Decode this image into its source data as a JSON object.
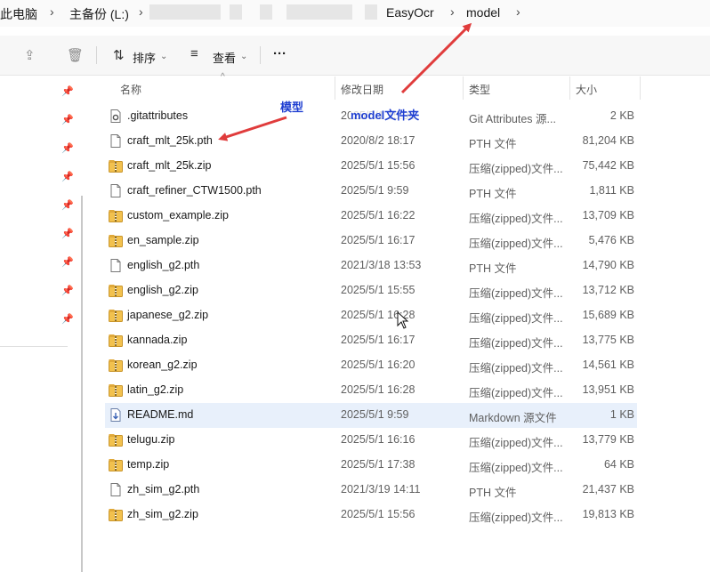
{
  "address_bar": {
    "crumbs": [
      "此电脑",
      "主备份 (L:)",
      "EasyOcr",
      "model"
    ]
  },
  "toolbar": {
    "sort_label": "排序",
    "view_label": "查看",
    "more_label": "···"
  },
  "columns": {
    "name": "名称",
    "date": "修改日期",
    "type": "类型",
    "size": "大小"
  },
  "files": [
    {
      "name": ".gitattributes",
      "date": "2025/5/1 15:06",
      "type": "Git Attributes 源...",
      "size": "2 KB",
      "icon": "settings-file"
    },
    {
      "name": "craft_mlt_25k.pth",
      "date": "2020/8/2 18:17",
      "type": "PTH 文件",
      "size": "81,204 KB",
      "icon": "file"
    },
    {
      "name": "craft_mlt_25k.zip",
      "date": "2025/5/1 15:56",
      "type": "压缩(zipped)文件...",
      "size": "75,442 KB",
      "icon": "zip"
    },
    {
      "name": "craft_refiner_CTW1500.pth",
      "date": "2025/5/1 9:59",
      "type": "PTH 文件",
      "size": "1,811 KB",
      "icon": "file"
    },
    {
      "name": "custom_example.zip",
      "date": "2025/5/1 16:22",
      "type": "压缩(zipped)文件...",
      "size": "13,709 KB",
      "icon": "zip"
    },
    {
      "name": "en_sample.zip",
      "date": "2025/5/1 16:17",
      "type": "压缩(zipped)文件...",
      "size": "5,476 KB",
      "icon": "zip"
    },
    {
      "name": "english_g2.pth",
      "date": "2021/3/18 13:53",
      "type": "PTH 文件",
      "size": "14,790 KB",
      "icon": "file"
    },
    {
      "name": "english_g2.zip",
      "date": "2025/5/1 15:55",
      "type": "压缩(zipped)文件...",
      "size": "13,712 KB",
      "icon": "zip"
    },
    {
      "name": "japanese_g2.zip",
      "date": "2025/5/1 16:28",
      "type": "压缩(zipped)文件...",
      "size": "15,689 KB",
      "icon": "zip"
    },
    {
      "name": "kannada.zip",
      "date": "2025/5/1 16:17",
      "type": "压缩(zipped)文件...",
      "size": "13,775 KB",
      "icon": "zip"
    },
    {
      "name": "korean_g2.zip",
      "date": "2025/5/1 16:20",
      "type": "压缩(zipped)文件...",
      "size": "14,561 KB",
      "icon": "zip"
    },
    {
      "name": "latin_g2.zip",
      "date": "2025/5/1 16:28",
      "type": "压缩(zipped)文件...",
      "size": "13,951 KB",
      "icon": "zip"
    },
    {
      "name": "README.md",
      "date": "2025/5/1 9:59",
      "type": "Markdown 源文件",
      "size": "1 KB",
      "icon": "md",
      "selected": true
    },
    {
      "name": "telugu.zip",
      "date": "2025/5/1 16:16",
      "type": "压缩(zipped)文件...",
      "size": "13,779 KB",
      "icon": "zip"
    },
    {
      "name": "temp.zip",
      "date": "2025/5/1 17:38",
      "type": "压缩(zipped)文件...",
      "size": "64 KB",
      "icon": "zip"
    },
    {
      "name": "zh_sim_g2.pth",
      "date": "2021/3/19 14:11",
      "type": "PTH 文件",
      "size": "21,437 KB",
      "icon": "file"
    },
    {
      "name": "zh_sim_g2.zip",
      "date": "2025/5/1 15:56",
      "type": "压缩(zipped)文件...",
      "size": "19,813 KB",
      "icon": "zip"
    }
  ],
  "annotations": {
    "model_label": "模型",
    "folder_label": "model文件夹",
    "arrow_color": "#e03c3c"
  }
}
